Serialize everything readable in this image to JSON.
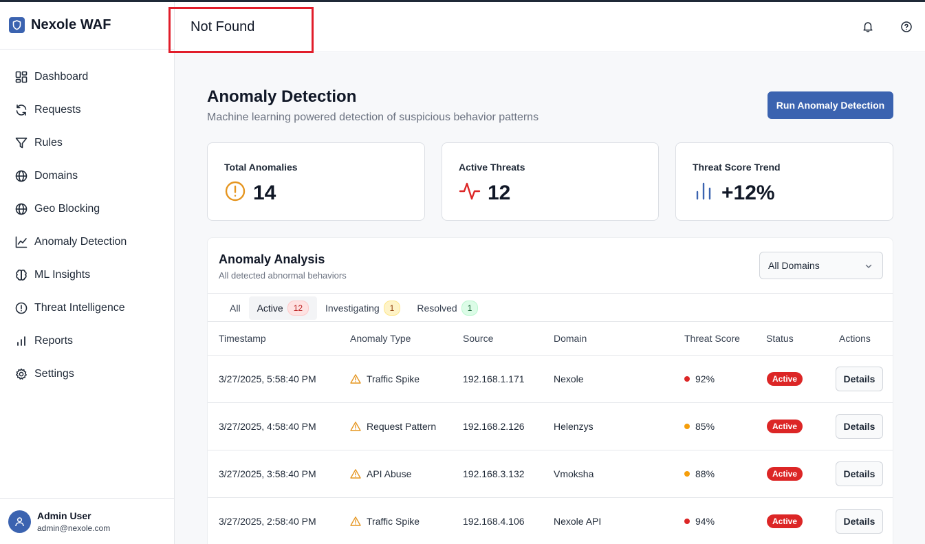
{
  "brand": {
    "name": "Nexole WAF",
    "accent": "#3b63b0"
  },
  "header": {
    "title": "Not Found",
    "icons": [
      "bell-icon",
      "help-circle-icon"
    ]
  },
  "sidebar": {
    "items": [
      {
        "label": "Dashboard",
        "icon": "dashboard-icon"
      },
      {
        "label": "Requests",
        "icon": "refresh-icon"
      },
      {
        "label": "Rules",
        "icon": "filter-icon"
      },
      {
        "label": "Domains",
        "icon": "globe-icon"
      },
      {
        "label": "Geo Blocking",
        "icon": "globe-icon"
      },
      {
        "label": "Anomaly Detection",
        "icon": "line-chart-icon"
      },
      {
        "label": "ML Insights",
        "icon": "brain-icon"
      },
      {
        "label": "Threat Intelligence",
        "icon": "alert-circle-icon"
      },
      {
        "label": "Reports",
        "icon": "bar-chart-icon"
      },
      {
        "label": "Settings",
        "icon": "gear-icon"
      }
    ],
    "user": {
      "name": "Admin User",
      "email": "admin@nexole.com"
    }
  },
  "main": {
    "title": "Anomaly Detection",
    "subtitle": "Machine learning powered detection of suspicious behavior patterns",
    "run_button": "Run Anomaly Detection",
    "cards": [
      {
        "label": "Total Anomalies",
        "value": "14",
        "icon": "alert-circle-icon",
        "color": "#e5951f"
      },
      {
        "label": "Active Threats",
        "value": "12",
        "icon": "activity-icon",
        "color": "#dc2626"
      },
      {
        "label": "Threat Score Trend",
        "value": "+12%",
        "icon": "bar-chart-icon",
        "color": "#3b63b0"
      }
    ],
    "panel": {
      "title": "Anomaly Analysis",
      "subtitle": "All detected abnormal behaviors",
      "select_value": "All Domains",
      "tabs": [
        {
          "label": "All",
          "count": null
        },
        {
          "label": "Active",
          "count": "12"
        },
        {
          "label": "Investigating",
          "count": "1"
        },
        {
          "label": "Resolved",
          "count": "1"
        }
      ],
      "columns": [
        "Timestamp",
        "Anomaly Type",
        "Source",
        "Domain",
        "Threat Score",
        "Status",
        "Actions"
      ],
      "rows": [
        {
          "timestamp": "3/27/2025, 5:58:40 PM",
          "type": "Traffic Spike",
          "source": "192.168.1.171",
          "domain": "Nexole",
          "score": "92%",
          "score_color": "#dc2626",
          "status": "Active",
          "action": "Details"
        },
        {
          "timestamp": "3/27/2025, 4:58:40 PM",
          "type": "Request Pattern",
          "source": "192.168.2.126",
          "domain": "Helenzys",
          "score": "85%",
          "score_color": "#f59e0b",
          "status": "Active",
          "action": "Details"
        },
        {
          "timestamp": "3/27/2025, 3:58:40 PM",
          "type": "API Abuse",
          "source": "192.168.3.132",
          "domain": "Vmoksha",
          "score": "88%",
          "score_color": "#f59e0b",
          "status": "Active",
          "action": "Details"
        },
        {
          "timestamp": "3/27/2025, 2:58:40 PM",
          "type": "Traffic Spike",
          "source": "192.168.4.106",
          "domain": "Nexole API",
          "score": "94%",
          "score_color": "#dc2626",
          "status": "Active",
          "action": "Details"
        }
      ]
    }
  }
}
